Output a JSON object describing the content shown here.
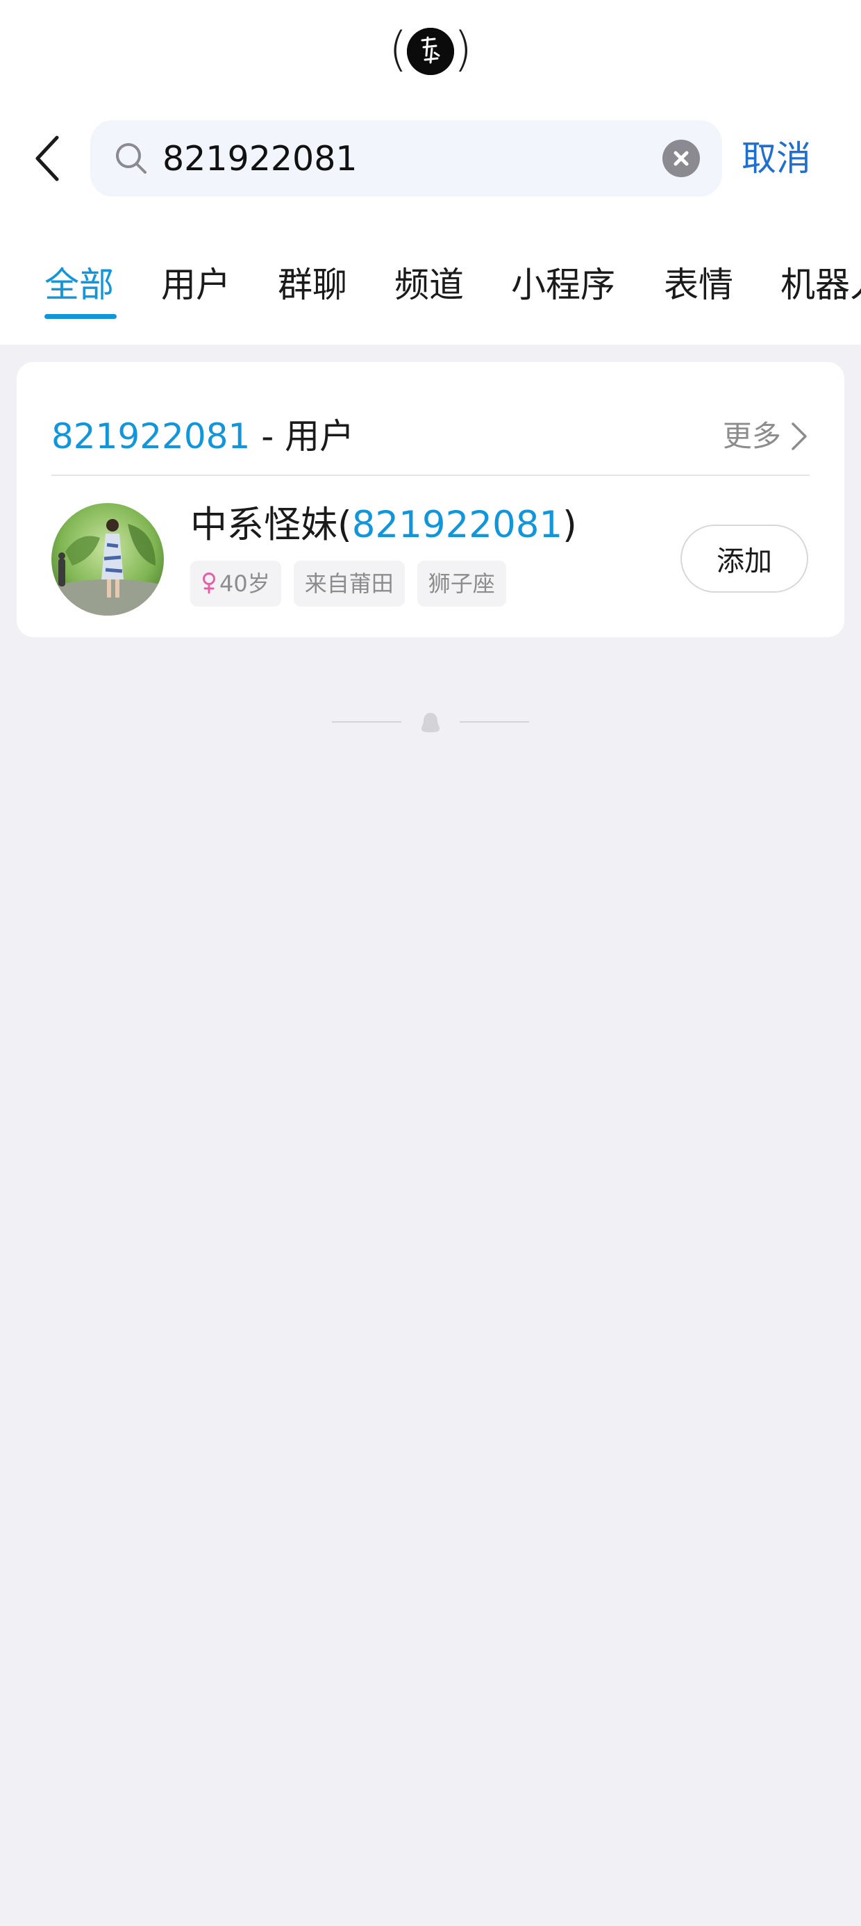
{
  "status_bar": {
    "logo_icon": "brand-seal-icon"
  },
  "search": {
    "query": "821922081",
    "placeholder": "",
    "cancel_label": "取消"
  },
  "tabs": [
    {
      "label": "全部",
      "active": true
    },
    {
      "label": "用户",
      "active": false
    },
    {
      "label": "群聊",
      "active": false
    },
    {
      "label": "频道",
      "active": false
    },
    {
      "label": "小程序",
      "active": false
    },
    {
      "label": "表情",
      "active": false
    },
    {
      "label": "机器人",
      "active": false
    }
  ],
  "user_section": {
    "keyword": "821922081",
    "suffix": " - 用户",
    "more_label": "更多",
    "result": {
      "name_prefix": "中系怪妹(",
      "name_id": "821922081",
      "name_suffix": ")",
      "tags": {
        "age": "40岁",
        "origin": "来自莆田",
        "zodiac": "狮子座"
      },
      "add_label": "添加"
    }
  },
  "colors": {
    "accent": "#1296db",
    "cancel": "#1f6fd1",
    "female": "#e65fa6",
    "background": "#f0f0f5"
  }
}
